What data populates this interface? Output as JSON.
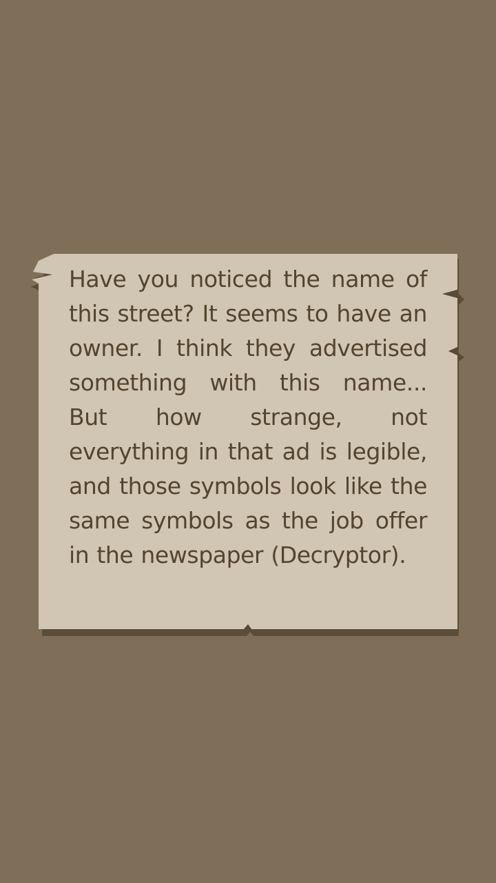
{
  "note": {
    "text": "Have you noticed the name of this street? It seems to have an owner. I think they advertised something with this name... But how strange, not everything in that ad is legible, and those symbols look like the same symbols as the job offer in the newspaper (Decryptor)."
  },
  "colors": {
    "background": "#7f6f58",
    "paper": "#d1c6b3",
    "shadow": "#4f4130",
    "text": "#54442f"
  }
}
